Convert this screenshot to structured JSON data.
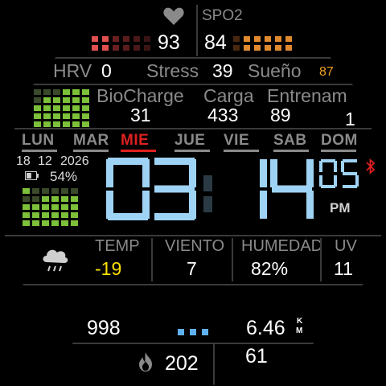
{
  "heart_rate": {
    "icon": "heart-icon",
    "value": "93"
  },
  "spo2": {
    "label": "SPO2",
    "value": "84"
  },
  "metrics_row": {
    "hrv_label": "HRV",
    "hrv_value": "0",
    "stress_label": "Stress",
    "stress_value": "39",
    "sleep_label": "Sueño",
    "sleep_value": "87"
  },
  "body_metrics": {
    "biocharge_label": "BioCharge",
    "biocharge_value": "31",
    "carga_label": "Carga",
    "carga_value": "433",
    "entrenam_label": "Entrenam",
    "entrenam_value": "89",
    "extra_value": "1"
  },
  "weekdays": [
    "LUN",
    "MAR",
    "MIE",
    "JUE",
    "VIE",
    "SAB",
    "DOM"
  ],
  "active_day": "MIE",
  "date": {
    "day": "18",
    "month": "12",
    "year": "2026"
  },
  "battery": {
    "percent_label": "54%",
    "level": 0.54
  },
  "time": {
    "hours": "03",
    "minutes": "14",
    "seconds": "05",
    "ampm": "PM",
    "bluetooth_icon": "bluetooth-icon"
  },
  "weather": {
    "icon": "rain-cloud-icon",
    "temp_label": "TEMP",
    "temp_value": "-19",
    "wind_label": "VIENTO",
    "wind_value": "7",
    "humidity_label": "HUMEDAD",
    "humidity_value": "82%",
    "uv_label": "UV",
    "uv_value": "11"
  },
  "bottom": {
    "left_value": "998",
    "distance_value": "6.46",
    "distance_unit_top": "K",
    "distance_unit_bottom": "M",
    "calories_icon": "flame-icon",
    "calories_value": "202",
    "right_value": "61"
  },
  "colors": {
    "accent_red": "#e02020",
    "digit_blue": "#9fd3f5",
    "temp_yellow": "#ffe000",
    "sleep_orange": "#f0a020",
    "bar_green": "#7dc03a",
    "bar_dim": "#3a4a2a",
    "hr_red": "#e05050",
    "spo2_orange": "#e08a30"
  }
}
